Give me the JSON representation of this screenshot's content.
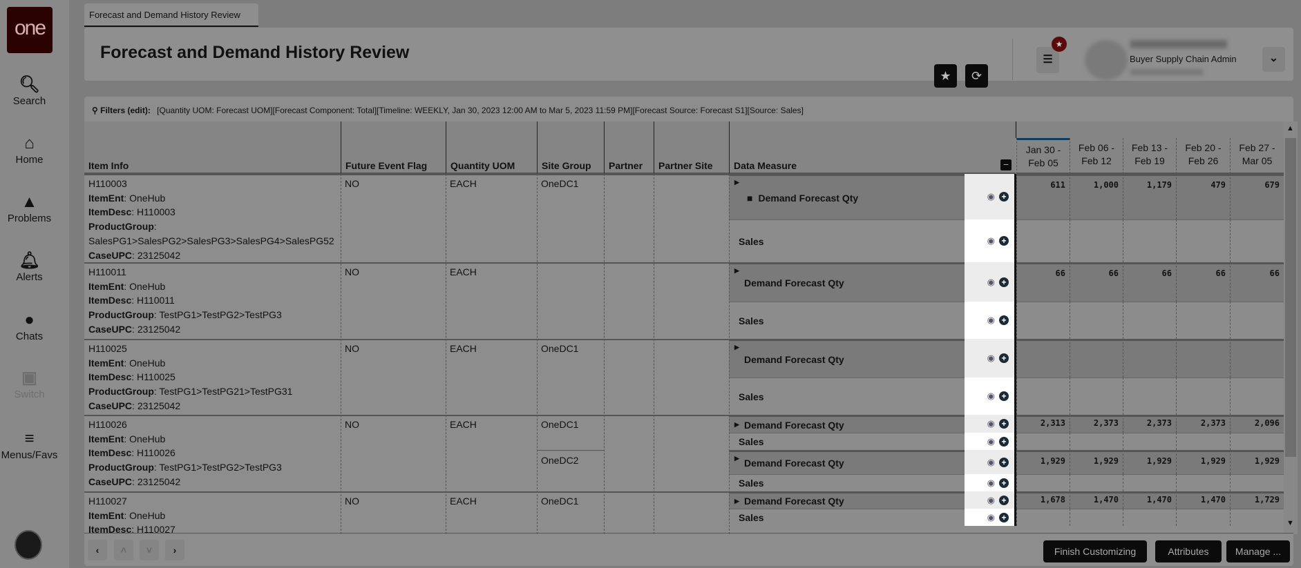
{
  "sidebar": {
    "logo": "one",
    "items": [
      {
        "label": "Search",
        "icon": "search-icon"
      },
      {
        "label": "Home",
        "icon": "home-icon"
      },
      {
        "label": "Problems",
        "icon": "warning-icon"
      },
      {
        "label": "Alerts",
        "icon": "bell-icon"
      },
      {
        "label": "Chats",
        "icon": "chat-icon"
      },
      {
        "label": "Switch",
        "icon": "switch-icon"
      },
      {
        "label": "Menus/Favs",
        "icon": "menu-icon"
      }
    ]
  },
  "tab": {
    "label": "Forecast and Demand History Review"
  },
  "header": {
    "title": "Forecast and Demand History Review",
    "user_role": "Buyer Supply Chain Admin"
  },
  "filters": {
    "label": "Filters (edit):",
    "text": "[Quantity UOM: Forecast UOM][Forecast Component: Total][Timeline: WEEKLY, Jan 30, 2023 12:00 AM to Mar 5, 2023 11:59 PM][Forecast Source: Forecast S1][Source: Sales]"
  },
  "columns": {
    "item_info": "Item Info",
    "future_event": "Future Event Flag",
    "qty_uom": "Quantity UOM",
    "site_group": "Site Group",
    "partner": "Partner",
    "partner_site": "Partner Site",
    "data_measure": "Data Measure"
  },
  "periods": [
    [
      "Jan 30 -",
      "Feb 05"
    ],
    [
      "Feb 06 -",
      "Feb 12"
    ],
    [
      "Feb 13 -",
      "Feb 19"
    ],
    [
      "Feb 20 -",
      "Feb 26"
    ],
    [
      "Feb 27 -",
      "Mar 05"
    ]
  ],
  "field_labels": {
    "ent": "ItemEnt",
    "desc": "ItemDesc",
    "pg": "ProductGroup",
    "upc": "CaseUPC"
  },
  "items": [
    {
      "id": "H110003",
      "ent": "OneHub",
      "desc": "H110003",
      "pg": "SalesPG1>SalesPG2>SalesPG3>SalesPG4>SalesPG52",
      "upc": "23125042",
      "flag": "NO",
      "uom": "EACH",
      "sites": [
        {
          "site": "OneDC1",
          "measures": [
            {
              "label": "Demand Forecast Qty",
              "values": [
                "611",
                "1,000",
                "1,179",
                "479",
                "679"
              ]
            },
            {
              "label": "Sales",
              "values": [
                "",
                "",
                "",
                "",
                ""
              ]
            }
          ]
        }
      ]
    },
    {
      "id": "H110011",
      "ent": "OneHub",
      "desc": "H110011",
      "pg": "TestPG1>TestPG2>TestPG3",
      "upc": "23125042",
      "flag": "NO",
      "uom": "EACH",
      "sites": [
        {
          "site": "",
          "measures": [
            {
              "label": "Demand Forecast Qty",
              "values": [
                "66",
                "66",
                "66",
                "66",
                "66"
              ]
            },
            {
              "label": "Sales",
              "values": [
                "",
                "",
                "",
                "",
                ""
              ]
            }
          ]
        }
      ]
    },
    {
      "id": "H110025",
      "ent": "OneHub",
      "desc": "H110025",
      "pg": "TestPG1>TestPG21>TestPG31",
      "upc": "23125042",
      "flag": "NO",
      "uom": "EACH",
      "sites": [
        {
          "site": "OneDC1",
          "measures": [
            {
              "label": "Demand Forecast Qty",
              "values": [
                "",
                "",
                "",
                "",
                ""
              ]
            },
            {
              "label": "Sales",
              "values": [
                "",
                "",
                "",
                "",
                ""
              ]
            }
          ]
        }
      ]
    },
    {
      "id": "H110026",
      "ent": "OneHub",
      "desc": "H110026",
      "pg": "TestPG1>TestPG2>TestPG3",
      "upc": "23125042",
      "flag": "NO",
      "uom": "EACH",
      "sites": [
        {
          "site": "OneDC1",
          "measures": [
            {
              "label": "Demand Forecast Qty",
              "values": [
                "2,313",
                "2,373",
                "2,373",
                "2,373",
                "2,096"
              ]
            },
            {
              "label": "Sales",
              "values": [
                "",
                "",
                "",
                "",
                ""
              ]
            }
          ]
        },
        {
          "site": "OneDC2",
          "measures": [
            {
              "label": "Demand Forecast Qty",
              "values": [
                "1,929",
                "1,929",
                "1,929",
                "1,929",
                "1,929"
              ]
            },
            {
              "label": "Sales",
              "values": [
                "",
                "",
                "",
                "",
                ""
              ]
            }
          ]
        }
      ]
    },
    {
      "id": "H110027",
      "ent": "OneHub",
      "desc": "H110027",
      "pg": "",
      "upc": "",
      "flag": "NO",
      "uom": "EACH",
      "sites": [
        {
          "site": "OneDC1",
          "measures": [
            {
              "label": "Demand Forecast Qty",
              "values": [
                "1,678",
                "1,470",
                "1,470",
                "1,470",
                "1,729"
              ]
            },
            {
              "label": "Sales",
              "values": [
                "",
                "",
                "",
                "",
                ""
              ]
            }
          ]
        }
      ]
    }
  ],
  "footer": {
    "finish": "Finish Customizing",
    "attributes": "Attributes",
    "manage": "Manage ..."
  },
  "colors": {
    "logo": "#2a0202",
    "badge": "#5a0a0a",
    "active_period": "#0d3b5e"
  }
}
